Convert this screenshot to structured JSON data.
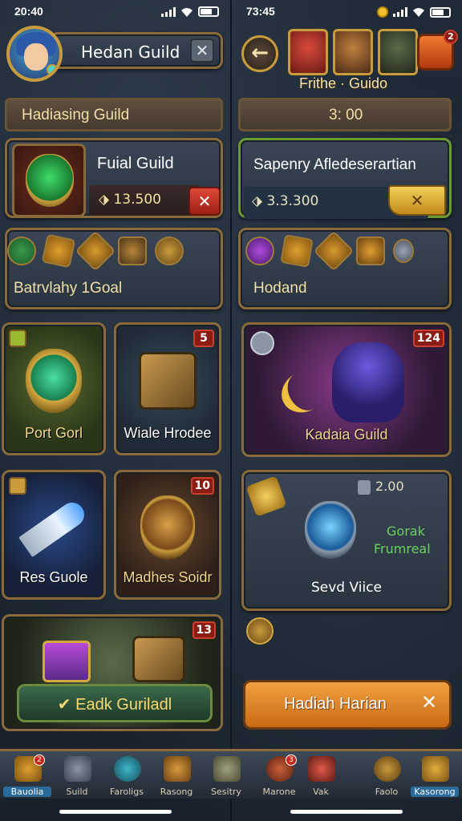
{
  "left": {
    "status": {
      "time": "20:40"
    },
    "header": {
      "title": "Hedan Guild",
      "close": "✕"
    },
    "bar1": "Hadiasing Guild",
    "feature": {
      "title": "Fuial Guild",
      "price": "13.500",
      "close": "✕"
    },
    "icons_title": "Batrvlahy 1Goal",
    "cards": [
      {
        "label": "Port Gorl"
      },
      {
        "label": "Wiale Hrodee",
        "badge": "5"
      },
      {
        "label": "Res Guole"
      },
      {
        "label": "Madhes Soidr",
        "badge": "10"
      }
    ],
    "bottom_card": {
      "badge": "13",
      "button": "Eadk Guriladl"
    }
  },
  "right": {
    "status": {
      "time": "73:45"
    },
    "header": {
      "title": "Frithe · Guido"
    },
    "bar1": "3: 00",
    "feature": {
      "title": "Sapenry Afledeserartian",
      "price": "3.3.300",
      "close": "✕"
    },
    "icons_title": "Hodand",
    "hero_card": {
      "label": "Kadaia Guild",
      "badge": "124"
    },
    "reward_card": {
      "cost": "2.00",
      "status1": "Gorak",
      "status2": "Frumreal",
      "label": "Sevd Viice"
    },
    "big_button": {
      "label": "Hadiah Harian",
      "close": "✕"
    }
  },
  "nav": [
    {
      "label": "Bauolia",
      "badge": "2"
    },
    {
      "label": "Suild"
    },
    {
      "label": "Faroligs"
    },
    {
      "label": "Rasong"
    },
    {
      "label": "Sesitry"
    },
    {
      "label": "Marone",
      "badge": "3"
    },
    {
      "label": "Vak"
    },
    {
      "label": "Faolo"
    },
    {
      "label": "Kasorong"
    }
  ]
}
